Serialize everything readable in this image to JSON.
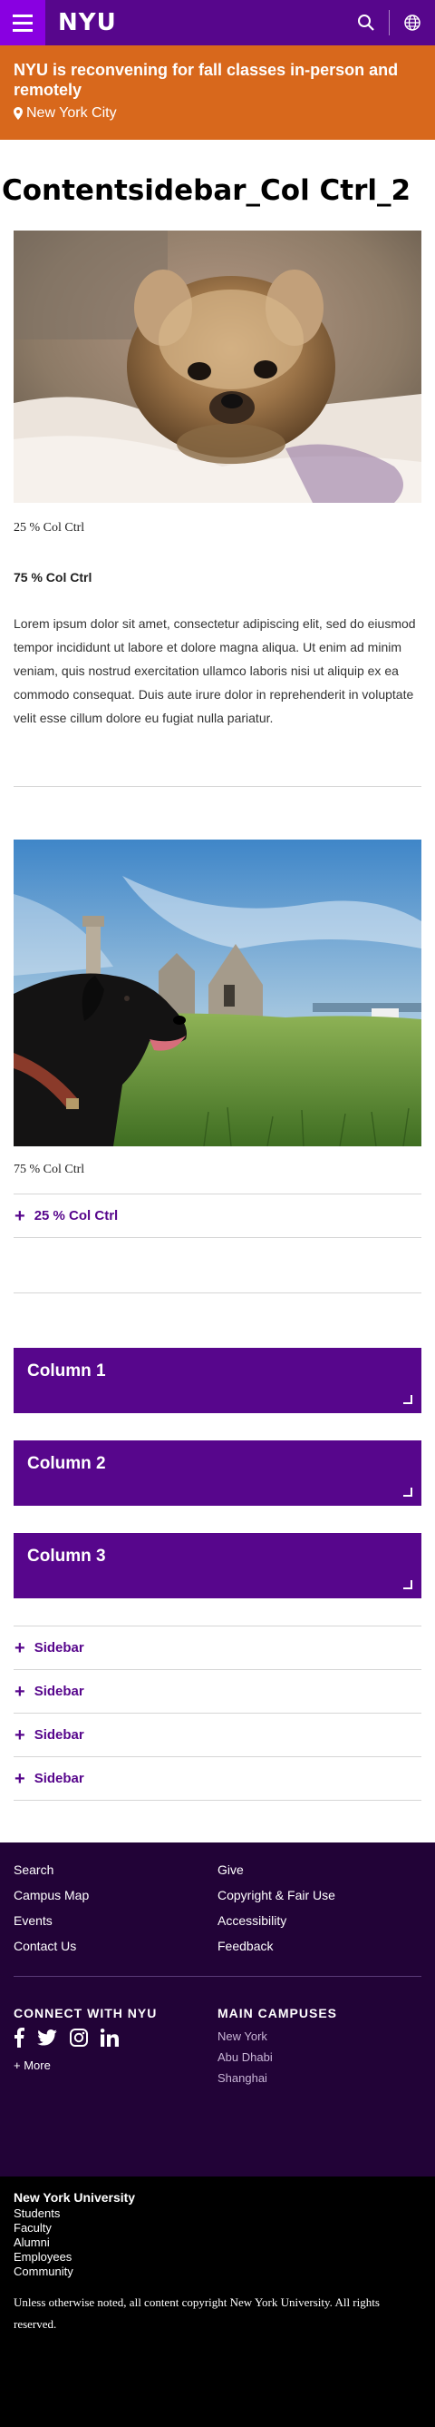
{
  "header": {
    "logo": "NYU",
    "icons": [
      "menu-icon",
      "search-icon",
      "globe-icon"
    ]
  },
  "alert": {
    "title": "NYU is reconvening for fall classes in-person and remotely",
    "location": "New York City"
  },
  "page": {
    "title": "Contentsidebar_Col Ctrl_2"
  },
  "section1": {
    "image_alt": "Small fluffy dog lying on a bed",
    "caption": "25 % Col Ctrl",
    "heading": "75 % Col Ctrl",
    "body": "Lorem ipsum dolor sit amet, consectetur adipiscing elit, sed do eiusmod tempor incididunt ut labore et dolore magna aliqua. Ut enim ad minim veniam, quis nostrud exercitation ullamco laboris nisi ut aliquip ex ea commodo consequat. Duis aute irure dolor in reprehenderit in voluptate velit esse cillum dolore eu fugiat nulla pariatur."
  },
  "section2": {
    "image_alt": "Black dog on grass in front of ruins",
    "caption": "75 % Col Ctrl",
    "accordion_label": "25 % Col Ctrl"
  },
  "columns": [
    {
      "label": "Column 1"
    },
    {
      "label": "Column 2"
    },
    {
      "label": "Column 3"
    }
  ],
  "sidebars": [
    {
      "label": "Sidebar"
    },
    {
      "label": "Sidebar"
    },
    {
      "label": "Sidebar"
    },
    {
      "label": "Sidebar"
    }
  ],
  "footer": {
    "links": [
      "Search",
      "Give",
      "Campus Map",
      "Copyright & Fair Use",
      "Events",
      "Accessibility",
      "Contact Us",
      "Feedback"
    ],
    "connect_heading": "CONNECT WITH NYU",
    "social_icons": [
      "facebook-icon",
      "twitter-icon",
      "instagram-icon",
      "linkedin-icon"
    ],
    "more": "+ More",
    "campuses_heading": "MAIN CAMPUSES",
    "campuses": [
      "New York",
      "Abu Dhabi",
      "Shanghai"
    ],
    "university": "New York University",
    "audience_links": [
      "Students",
      "Faculty",
      "Alumni",
      "Employees",
      "Community"
    ],
    "copyright": "Unless otherwise noted, all content copyright New York University. All rights reserved."
  },
  "colors": {
    "brand_purple": "#57068c",
    "menu_purple": "#8900e1",
    "alert_orange": "#d8681c",
    "footer_dark": "#220337"
  }
}
